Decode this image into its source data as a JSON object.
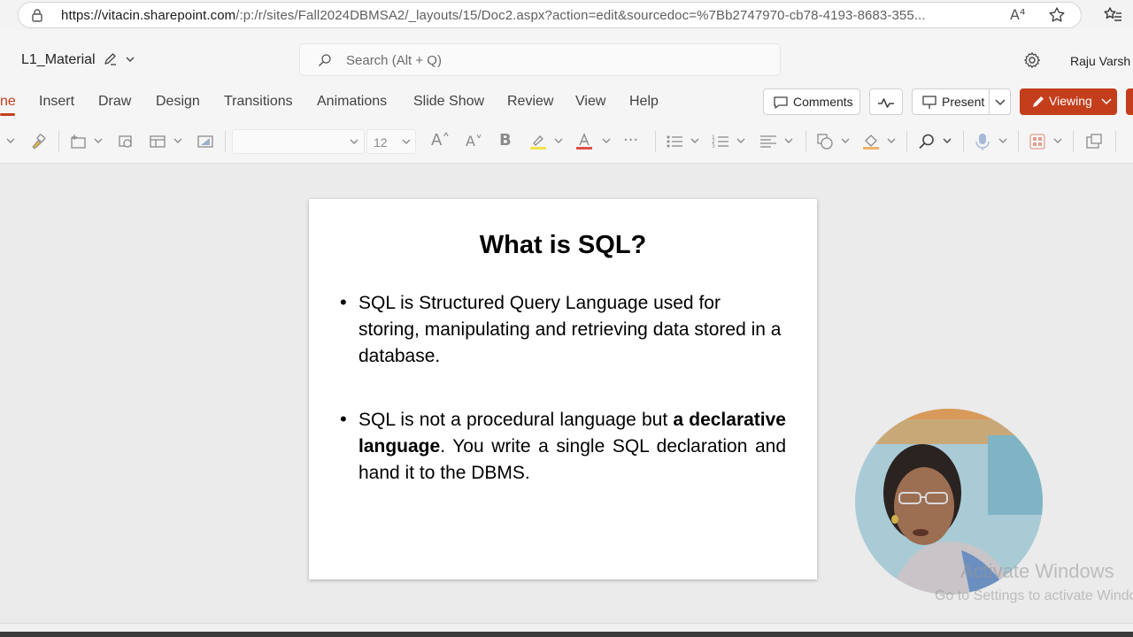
{
  "browser": {
    "url_host": "https://vitacin.sharepoint.com",
    "url_rest": "/:p:/r/sites/Fall2024DBMSA2/_layouts/15/Doc2.aspx?action=edit&sourcedoc=%7Bb2747970-cb78-4193-8683-355...",
    "read_aloud_glyph": "A⁴"
  },
  "header": {
    "doc_title": "L1_Material",
    "search_placeholder": "Search (Alt + Q)",
    "user_name": "Raju Varsh"
  },
  "ribbon": {
    "tabs": [
      {
        "label": "ne",
        "active": true
      },
      {
        "label": "Insert"
      },
      {
        "label": "Draw"
      },
      {
        "label": "Design"
      },
      {
        "label": "Transitions"
      },
      {
        "label": "Animations"
      },
      {
        "label": "Slide Show"
      },
      {
        "label": "Review"
      },
      {
        "label": "View"
      },
      {
        "label": "Help"
      }
    ],
    "comments_label": "Comments",
    "present_label": "Present",
    "viewing_label": "Viewing"
  },
  "toolbar": {
    "font_size": "12",
    "glyphs": {
      "grow": "A˄",
      "shrink": "A˅",
      "bold": "B",
      "more": "···"
    }
  },
  "slide": {
    "title": "What is SQL?",
    "bullet_glyph": "•",
    "bullet1": "SQL is Structured Query Language used for storing, manipulating and retrieving data stored in a database.",
    "bullet2_pre": "SQL is not a procedural language but ",
    "bullet2_bold": "a declarative language",
    "bullet2_post": ". You write a single SQL declaration and hand it to the DBMS."
  },
  "watermark": {
    "line1": "Activate Windows",
    "line2": "Go to Settings to activate Windows."
  },
  "colors": {
    "accent": "#c43e1c",
    "ribbon_bg": "#f5f5f5",
    "canvas_bg": "#ebebeb"
  }
}
